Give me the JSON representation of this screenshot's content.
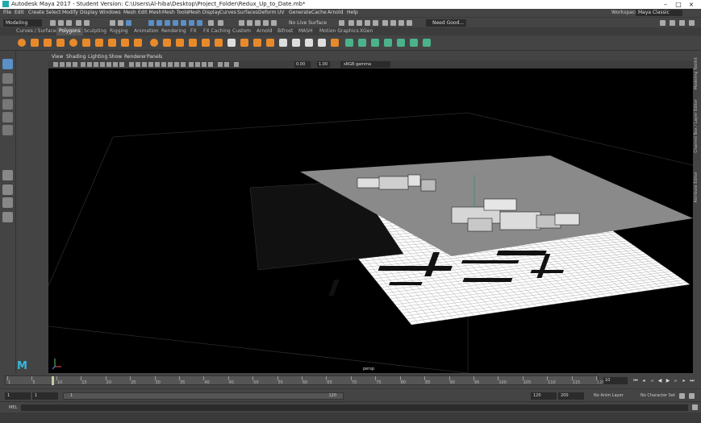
{
  "window": {
    "title": "Autodesk Maya 2017 - Student Version: C:\\Users\\Al-hiba\\Desktop\\Project_Folder\\Redux_Up_to_Date.mb*",
    "controls": [
      "–",
      "□",
      "×"
    ]
  },
  "menubar": {
    "items": [
      "File",
      "Edit",
      "Create",
      "Select",
      "Modify",
      "Display",
      "Windows",
      "Mesh",
      "Edit Mesh",
      "Mesh Tools",
      "Mesh Display",
      "Curves",
      "Surfaces",
      "Deform",
      "UV",
      "Generate",
      "Cache",
      "Arnold",
      "Help"
    ],
    "workspace_label": "Workspace :",
    "workspace_value": "Maya Classic"
  },
  "status_line": {
    "mode": "Modeling",
    "live_surface": "No Live Surface",
    "workspace_selector": "Need Good..."
  },
  "shelf": {
    "tabs": [
      "Curves / Surfaces",
      "Polygons",
      "Sculpting",
      "Rigging",
      "Animation",
      "Rendering",
      "FX",
      "FX Caching",
      "Custom",
      "Arnold",
      "Bifrost",
      "MASH",
      "Motion Graphics",
      "XGen"
    ],
    "active_tab": "Polygons",
    "colors": {
      "orange": "#e88a2a",
      "green": "#4bb28a",
      "white": "#dddddd"
    }
  },
  "panel": {
    "menus": [
      "View",
      "Shading",
      "Lighting",
      "Show",
      "Renderer",
      "Panels"
    ],
    "field_a": "0.00",
    "field_b": "1.00",
    "colorspace": "sRGB gamma",
    "camera_label": "persp"
  },
  "right_strip": {
    "labels": [
      "Modeling Toolkit",
      "Channel Box / Layer Editor",
      "Attribute Editor"
    ]
  },
  "time_slider": {
    "tick_labels": [
      "1",
      "5",
      "10",
      "15",
      "20",
      "25",
      "30",
      "35",
      "40",
      "45",
      "50",
      "55",
      "60",
      "65",
      "70",
      "75",
      "80",
      "85",
      "90",
      "95",
      "100",
      "105",
      "110",
      "115",
      "120"
    ],
    "current_frame": "10",
    "current_fraction": 0.076
  },
  "range_slider": {
    "start": "1",
    "anim_start": "1",
    "range_start": "1",
    "range_end": "120",
    "anim_end": "120",
    "end": "200",
    "anim_layer": "No Anim Layer",
    "character_set": "No Character Set"
  },
  "command_line": {
    "label": "MEL"
  },
  "viewport_floor_color": "#ffffff",
  "viewport_plane_color": "#8a8a8a"
}
